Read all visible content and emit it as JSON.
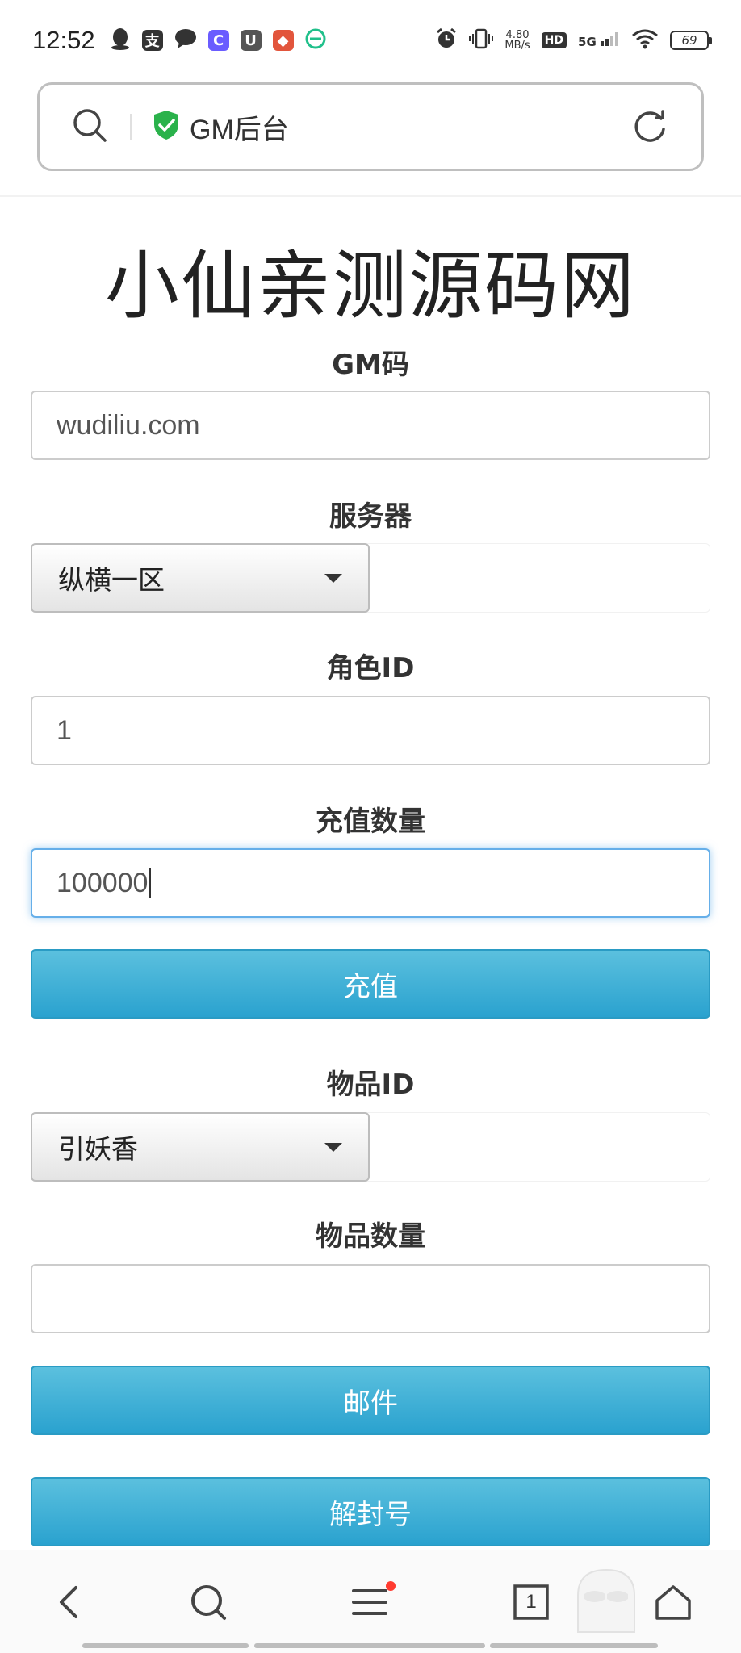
{
  "status_bar": {
    "time": "12:52",
    "network_speed_value": "4.80",
    "network_speed_unit": "MB/s",
    "hd_label": "HD",
    "network_type": "5G",
    "battery": "69",
    "notification_icons": [
      "qq-icon",
      "alipay-icon",
      "message-icon",
      "c-app-icon",
      "uc-browser-icon",
      "game-app-icon",
      "browser-e-icon"
    ]
  },
  "url_bar": {
    "title": "GM后台",
    "secure": true
  },
  "site": {
    "title": "小仙亲测源码网"
  },
  "form": {
    "gm_code": {
      "label": "GM码",
      "value": "wudiliu.com"
    },
    "server": {
      "label": "服务器",
      "selected": "纵横一区"
    },
    "role_id": {
      "label": "角色ID",
      "value": "1"
    },
    "recharge_amount": {
      "label": "充值数量",
      "value": "100000"
    },
    "recharge_button": "充值",
    "item_id": {
      "label": "物品ID",
      "selected": "引妖香"
    },
    "item_quantity": {
      "label": "物品数量",
      "value": ""
    },
    "mail_button": "邮件",
    "unban_button": "解封号"
  },
  "bottom_nav": {
    "tab_count": "1",
    "items": [
      "back-icon",
      "search-icon",
      "menu-icon",
      "tabs-icon",
      "home-icon"
    ]
  },
  "colors": {
    "primary_button": "#2aa2cf",
    "focus_border": "#66afe9",
    "secure_shield": "#2ab24b"
  }
}
